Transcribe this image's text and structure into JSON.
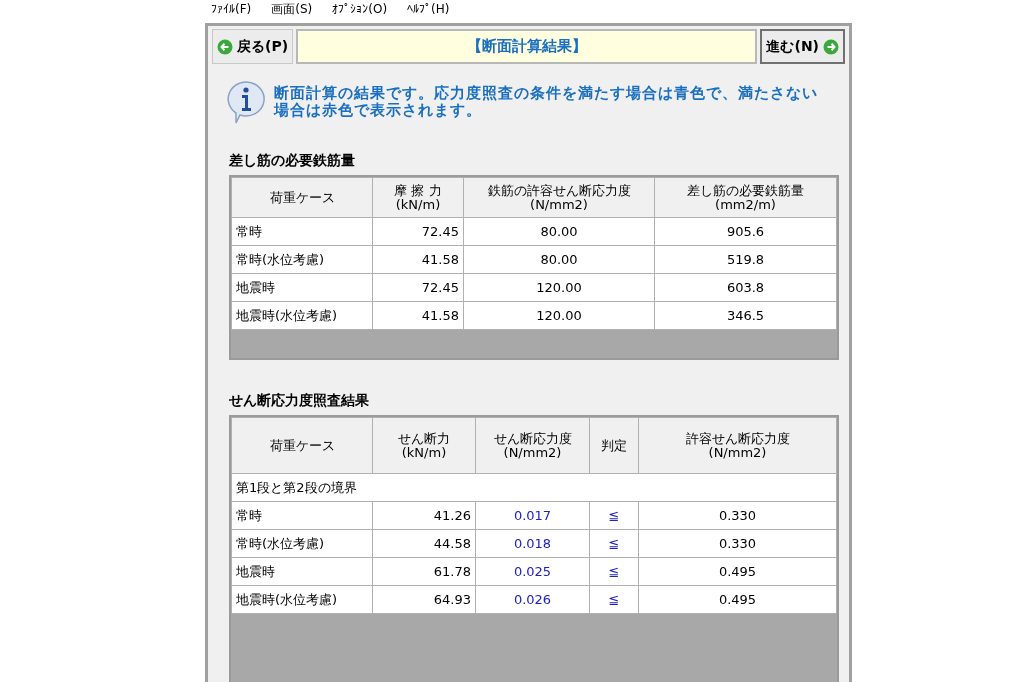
{
  "menu": [
    "ﾌｧｲﾙ(F)",
    "画面(S)",
    "ｵﾌﾟｼｮﾝ(O)",
    "ﾍﾙﾌﾟ(H)"
  ],
  "nav": {
    "back": "戻る(P)",
    "title": "【断面計算結果】",
    "next": "進む(N)"
  },
  "info": "断面計算の結果です。応力度照査の条件を満たす場合は青色で、満たさない場合は赤色で表示されます。",
  "rebar": {
    "title": "差し筋の必要鉄筋量",
    "columns": [
      "荷重ケース",
      "摩 擦 力\n(kN/m)",
      "鉄筋の許容せん断応力度\n(N/mm2)",
      "差し筋の必要鉄筋量\n(mm2/m)"
    ],
    "rows": [
      [
        "常時",
        "72.45",
        "80.00",
        "905.6"
      ],
      [
        "常時(水位考慮)",
        "41.58",
        "80.00",
        "519.8"
      ],
      [
        "地震時",
        "72.45",
        "120.00",
        "603.8"
      ],
      [
        "地震時(水位考慮)",
        "41.58",
        "120.00",
        "346.5"
      ]
    ]
  },
  "shear": {
    "title": "せん断応力度照査結果",
    "columns": [
      "荷重ケース",
      "せん断力\n(kN/m)",
      "せん断応力度\n(N/mm2)",
      "判定",
      "許容せん断応力度\n(N/mm2)"
    ],
    "group": "第1段と第2段の境界",
    "rows": [
      {
        "case": "常時",
        "force": "41.26",
        "stress": "0.017",
        "judge": "≦",
        "allow": "0.330",
        "ok": true
      },
      {
        "case": "常時(水位考慮)",
        "force": "44.58",
        "stress": "0.018",
        "judge": "≦",
        "allow": "0.330",
        "ok": true
      },
      {
        "case": "地震時",
        "force": "61.78",
        "stress": "0.025",
        "judge": "≦",
        "allow": "0.495",
        "ok": true
      },
      {
        "case": "地震時(水位考慮)",
        "force": "64.93",
        "stress": "0.026",
        "judge": "≦",
        "allow": "0.495",
        "ok": true
      }
    ]
  }
}
